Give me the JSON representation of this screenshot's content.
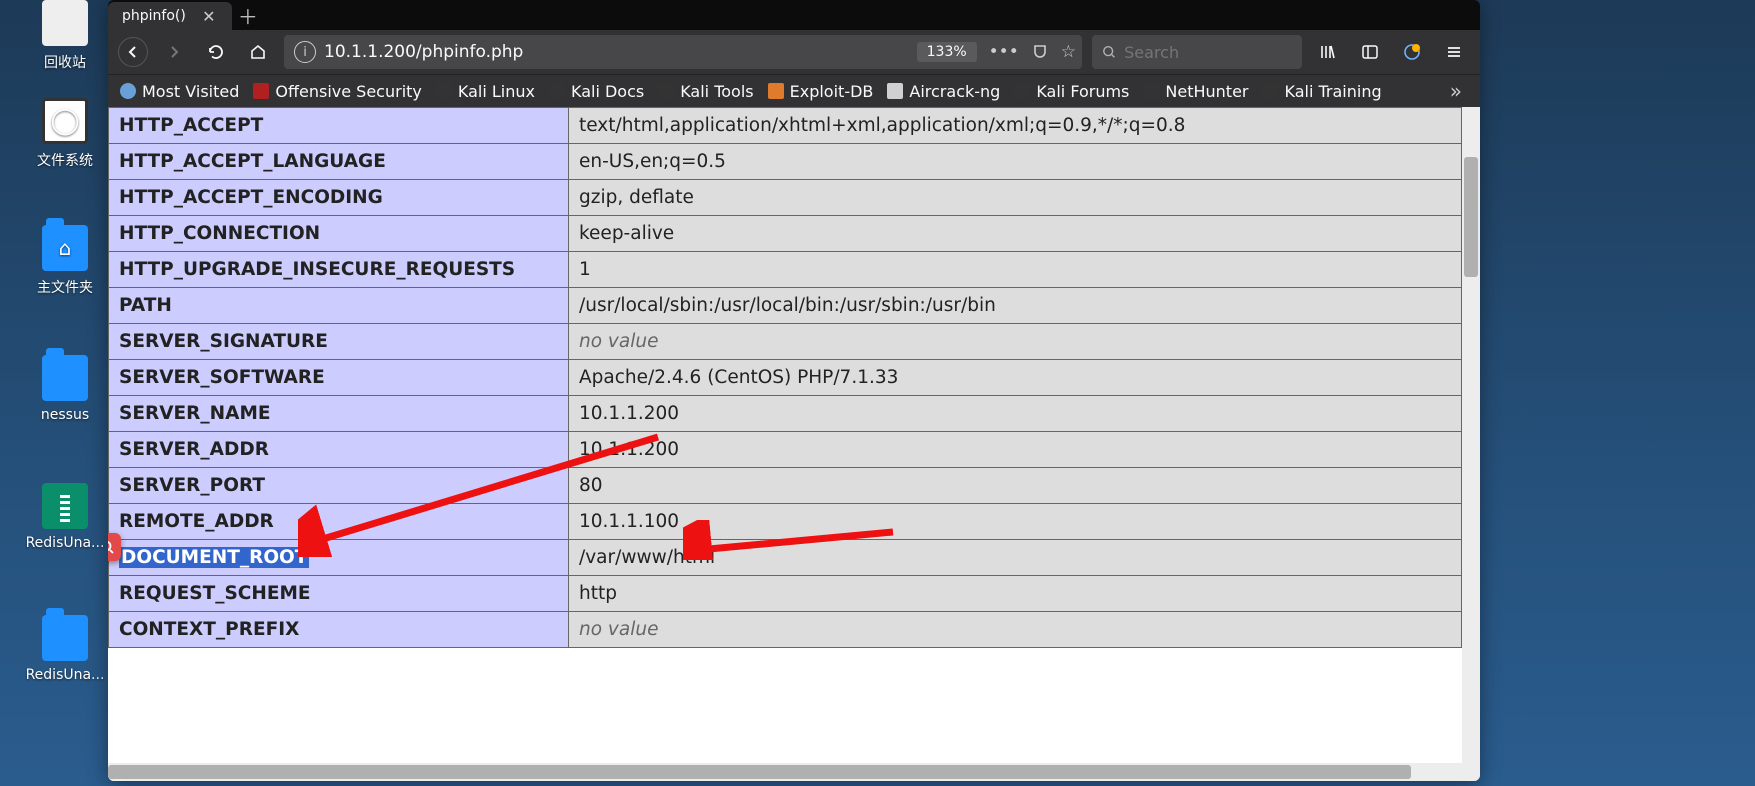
{
  "desktop": {
    "icons": [
      {
        "label": "回收站",
        "kind": "trash"
      },
      {
        "label": "文件系统",
        "kind": "wbox"
      },
      {
        "label": "主文件夹",
        "kind": "folder-home"
      },
      {
        "label": "nessus",
        "kind": "folder"
      },
      {
        "label": "RedisUna...",
        "kind": "zip"
      },
      {
        "label": "RedisUna...",
        "kind": "folder"
      }
    ]
  },
  "browser": {
    "tab_title": "phpinfo()",
    "url": "10.1.1.200/phpinfo.php",
    "zoom": "133%",
    "search_placeholder": "Search",
    "bookmarks": [
      {
        "label": "Most Visited",
        "color": "#6aa0d8"
      },
      {
        "label": "Offensive Security",
        "color": "#b02020"
      },
      {
        "label": "Kali Linux",
        "color": "#333"
      },
      {
        "label": "Kali Docs",
        "color": "#333"
      },
      {
        "label": "Kali Tools",
        "color": "#333"
      },
      {
        "label": "Exploit-DB",
        "color": "#e07b2e"
      },
      {
        "label": "Aircrack-ng",
        "color": "#d0d0d0"
      },
      {
        "label": "Kali Forums",
        "color": "#333"
      },
      {
        "label": "NetHunter",
        "color": "#333"
      },
      {
        "label": "Kali Training",
        "color": "#333"
      }
    ]
  },
  "phpinfo": {
    "rows": [
      {
        "key": "HTTP_ACCEPT",
        "val": "text/html,application/xhtml+xml,application/xml;q=0.9,*/*;q=0.8"
      },
      {
        "key": "HTTP_ACCEPT_LANGUAGE",
        "val": "en-US,en;q=0.5"
      },
      {
        "key": "HTTP_ACCEPT_ENCODING",
        "val": "gzip, deflate"
      },
      {
        "key": "HTTP_CONNECTION",
        "val": "keep-alive"
      },
      {
        "key": "HTTP_UPGRADE_INSECURE_REQUESTS",
        "val": "1"
      },
      {
        "key": "PATH",
        "val": "/usr/local/sbin:/usr/local/bin:/usr/sbin:/usr/bin"
      },
      {
        "key": "SERVER_SIGNATURE",
        "val": "no value",
        "novalue": true
      },
      {
        "key": "SERVER_SOFTWARE",
        "val": "Apache/2.4.6 (CentOS) PHP/7.1.33"
      },
      {
        "key": "SERVER_NAME",
        "val": "10.1.1.200"
      },
      {
        "key": "SERVER_ADDR",
        "val": "10.1.1.200"
      },
      {
        "key": "SERVER_PORT",
        "val": "80"
      },
      {
        "key": "REMOTE_ADDR",
        "val": "10.1.1.100"
      },
      {
        "key": "DOCUMENT_ROOT",
        "val": "/var/www/html",
        "highlight": true
      },
      {
        "key": "REQUEST_SCHEME",
        "val": "http"
      },
      {
        "key": "CONTEXT_PREFIX",
        "val": "no value",
        "novalue": true
      }
    ]
  }
}
